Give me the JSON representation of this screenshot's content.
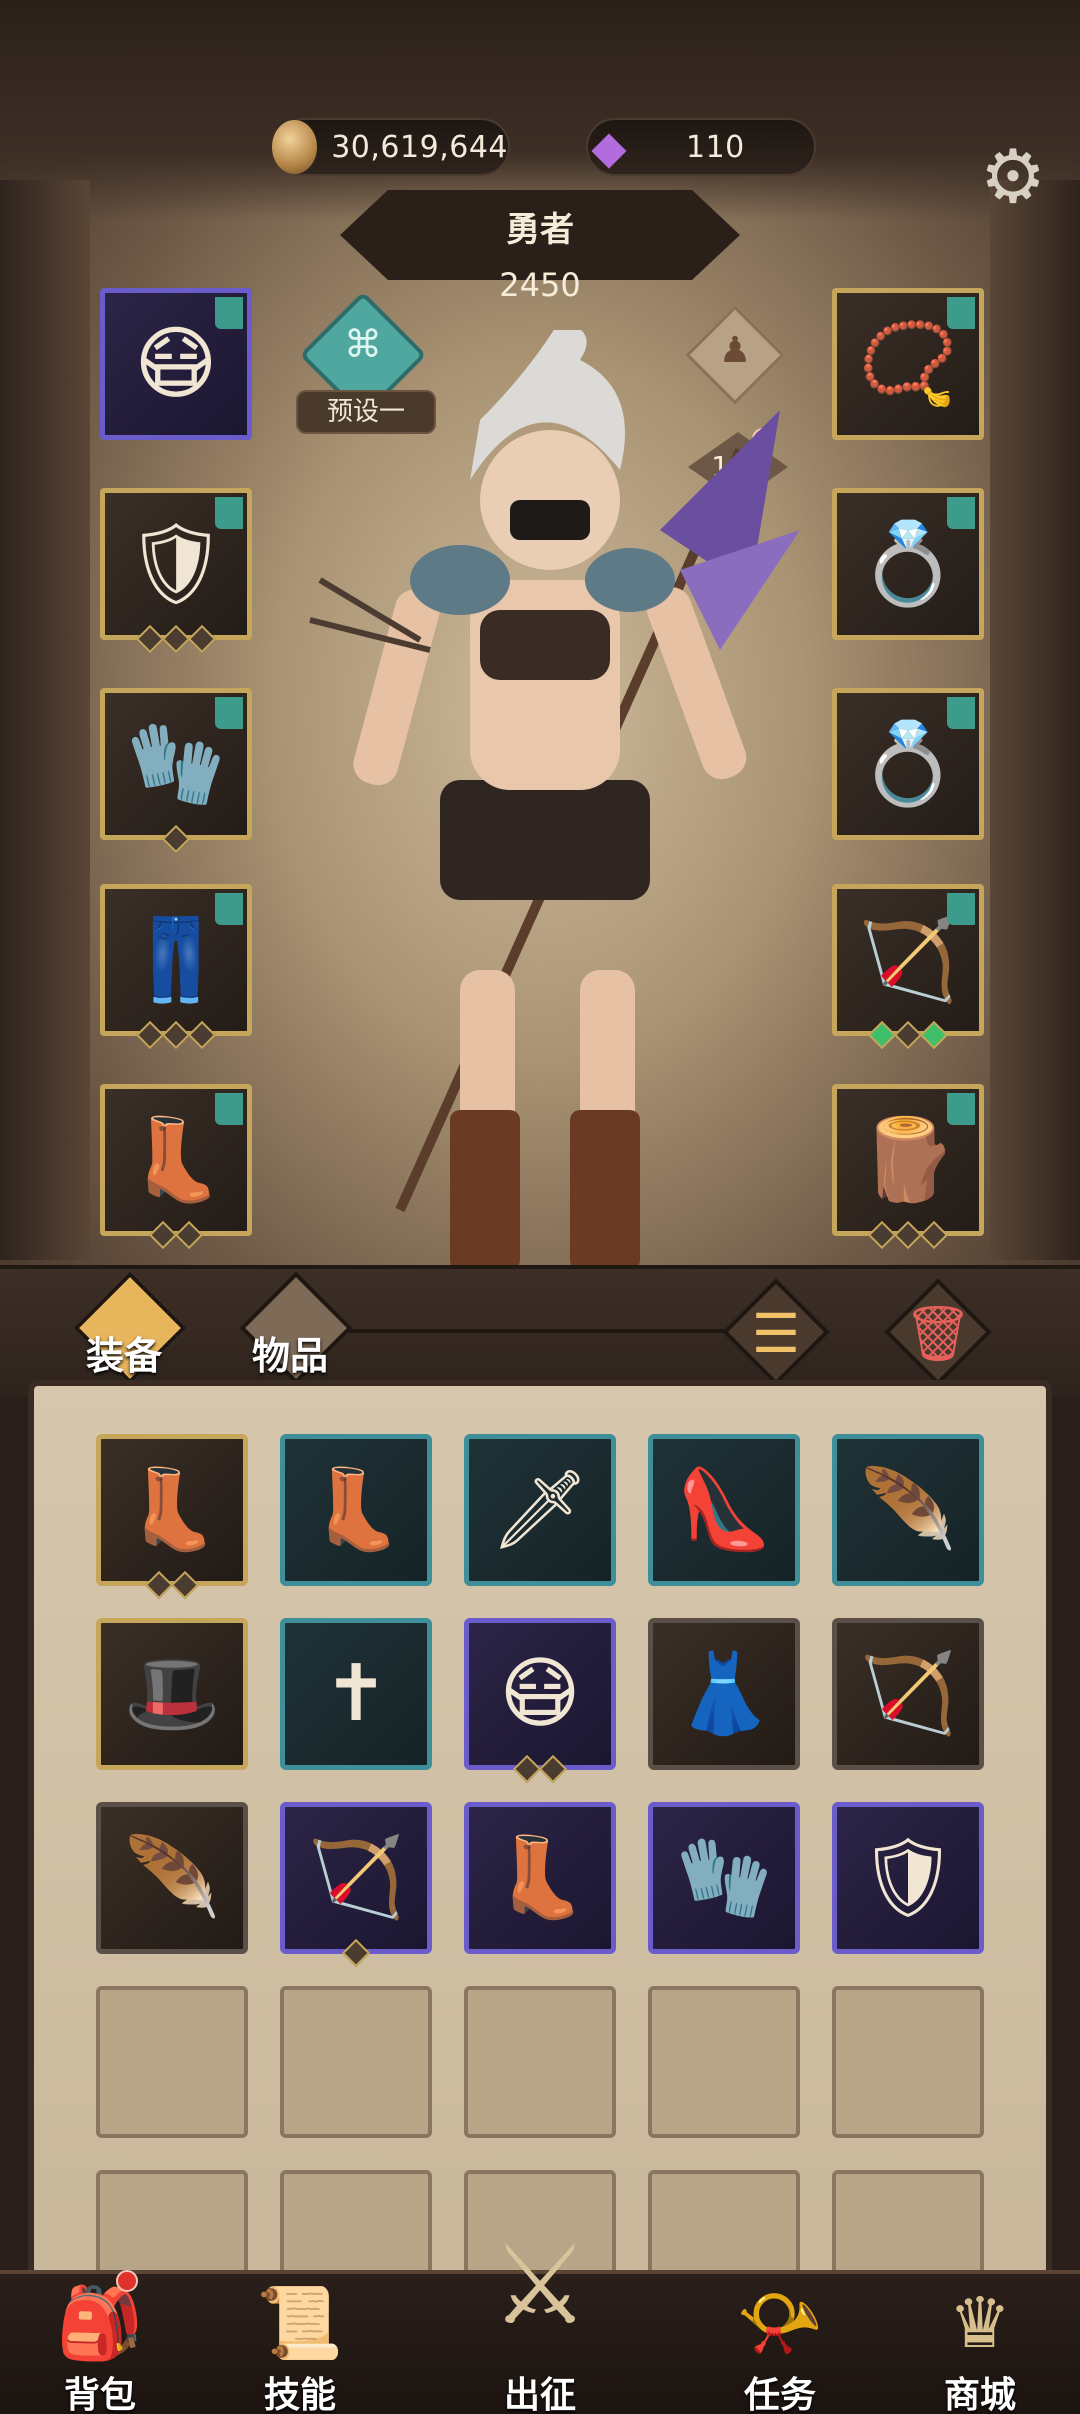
{
  "currency": {
    "gold": "30,619,644",
    "gems": "110"
  },
  "hero": {
    "title": "勇者",
    "power": "2450",
    "preset_label": "预设一",
    "level": "111"
  },
  "tabs": {
    "equipment": "装备",
    "items": "物品"
  },
  "bottom_nav": {
    "bag": "背包",
    "skills": "技能",
    "expedition": "出征",
    "quests": "任务",
    "shop": "商城"
  },
  "colors": {
    "gold_frame": "#c6a65a",
    "purple_frame": "#6b5ccc",
    "teal_frame": "#3e8f9a",
    "accent_orange": "#e7b55c",
    "alert_red": "#e0322c"
  },
  "icons": {
    "gold": "coin-icon",
    "gem": "gem-icon",
    "settings": "gear-icon",
    "sort": "sort-icon",
    "trash": "trash-icon"
  }
}
